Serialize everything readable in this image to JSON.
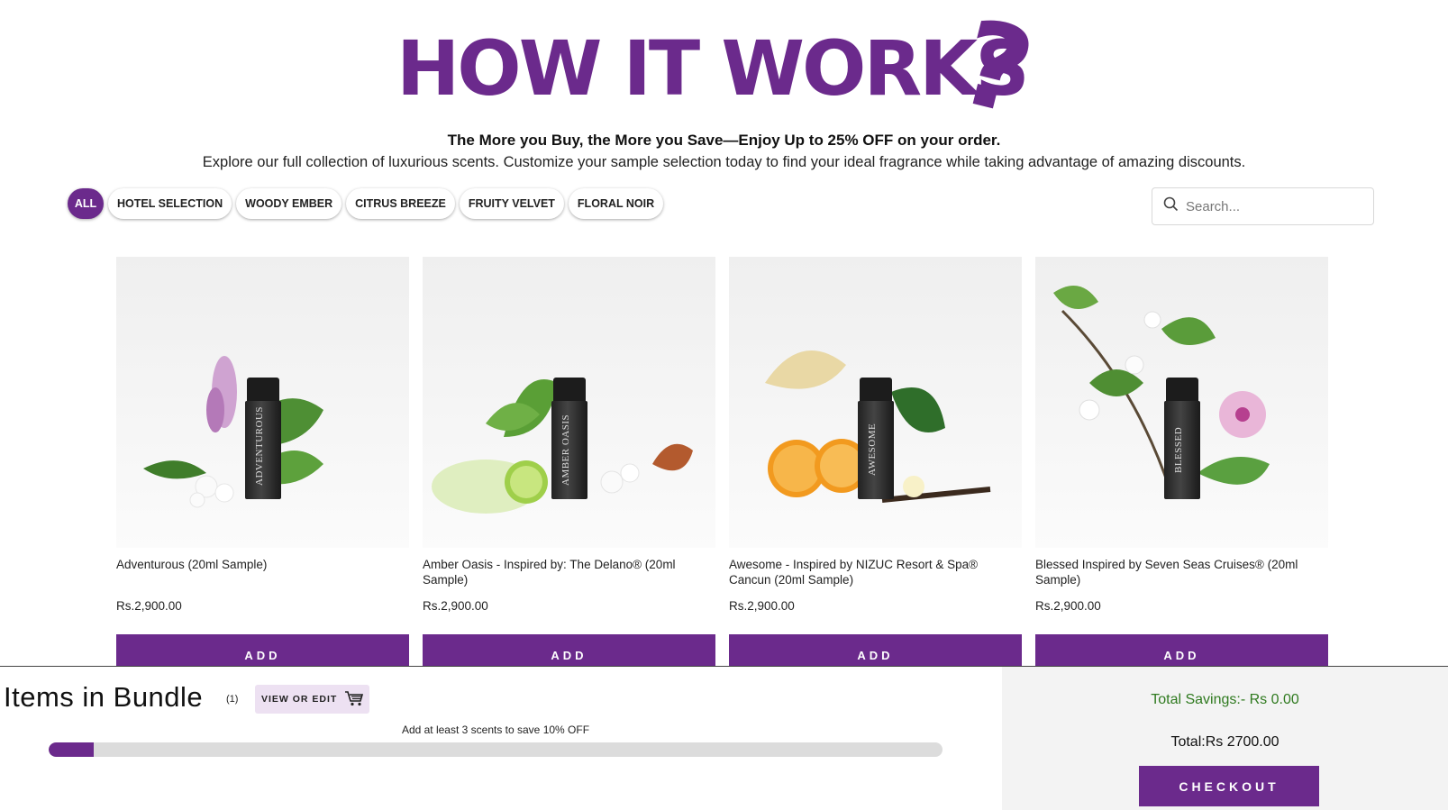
{
  "hero": {
    "title": "HOW IT WORKS",
    "title_mark": "?",
    "tagline": "The More you Buy, the More you Save—Enjoy Up to 25% OFF on your order.",
    "subline": "Explore our full collection of luxurious scents. Customize your sample selection today to find your ideal fragrance while taking advantage of amazing discounts."
  },
  "filters": [
    "ALL",
    "HOTEL SELECTION",
    "WOODY EMBER",
    "CITRUS BREEZE",
    "FRUITY VELVET",
    "FLORAL NOIR"
  ],
  "active_filter": "ALL",
  "search": {
    "placeholder": "Search...",
    "icon": "search-icon"
  },
  "products": [
    {
      "name": "Adventurous (20ml Sample)",
      "price": "Rs.2,900.00",
      "button": "ADD",
      "bottle_label": "ADVENTUROUS"
    },
    {
      "name": "Amber Oasis - Inspired by: The Delano® (20ml Sample)",
      "price": "Rs.2,900.00",
      "button": "ADD",
      "bottle_label": "AMBER OASIS"
    },
    {
      "name": "Awesome - Inspired by NIZUC Resort & Spa® Cancun (20ml Sample)",
      "price": "Rs.2,900.00",
      "button": "ADD",
      "bottle_label": "AWESOME"
    },
    {
      "name": "Blessed Inspired by Seven Seas Cruises® (20ml Sample)",
      "price": "Rs.2,900.00",
      "button": "ADD",
      "bottle_label": "BLESSED"
    }
  ],
  "bundle": {
    "title": "Items in Bundle",
    "count": "(1)",
    "view_edit": "VIEW OR EDIT",
    "cart_icon": "cart-icon",
    "progress_text": "Add at least 3 scents to save 10% OFF",
    "progress_fraction": 0.05,
    "savings": "Total Savings:- Rs 0.00",
    "total": "Total:Rs 2700.00",
    "checkout": "CHECKOUT"
  },
  "colors": {
    "brand": "#6b2a8c",
    "savings": "#2f7a1f",
    "progress_track": "#dcdcdc"
  }
}
